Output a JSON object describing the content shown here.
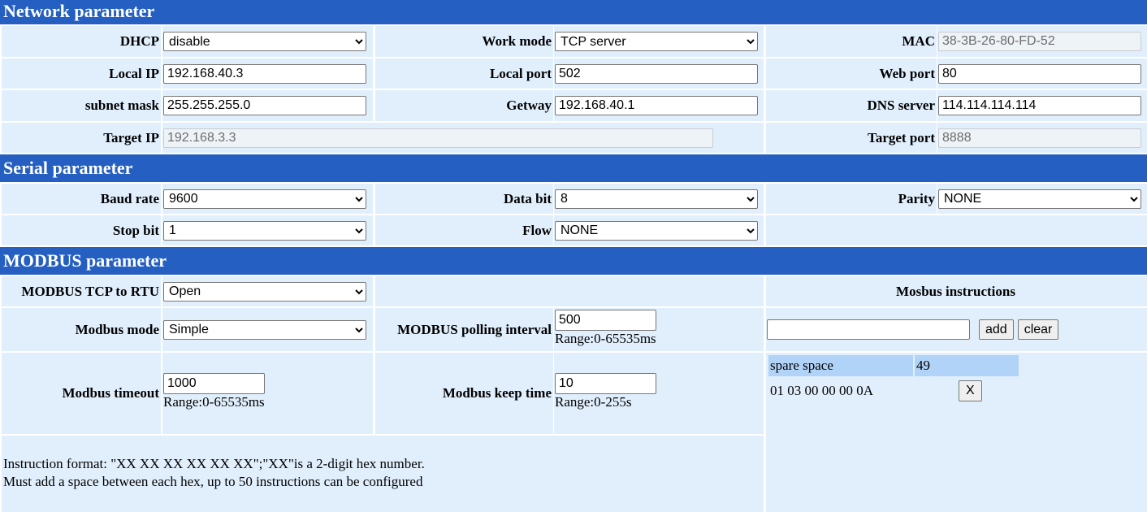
{
  "network": {
    "title": "Network parameter",
    "dhcp_label": "DHCP",
    "dhcp": "disable",
    "work_mode_label": "Work mode",
    "work_mode": "TCP server",
    "mac_label": "MAC",
    "mac": "38-3B-26-80-FD-52",
    "local_ip_label": "Local IP",
    "local_ip": "192.168.40.3",
    "local_port_label": "Local port",
    "local_port": "502",
    "web_port_label": "Web port",
    "web_port": "80",
    "subnet_label": "subnet mask",
    "subnet": "255.255.255.0",
    "gateway_label": "Getway",
    "gateway": "192.168.40.1",
    "dns_label": "DNS server",
    "dns": "114.114.114.114",
    "target_ip_label": "Target IP",
    "target_ip": "192.168.3.3",
    "target_port_label": "Target port",
    "target_port": "8888"
  },
  "serial": {
    "title": "Serial parameter",
    "baud_label": "Baud rate",
    "baud": "9600",
    "data_bit_label": "Data bit",
    "data_bit": "8",
    "parity_label": "Parity",
    "parity": "NONE",
    "stop_bit_label": "Stop bit",
    "stop_bit": "1",
    "flow_label": "Flow",
    "flow": "NONE"
  },
  "modbus": {
    "title": "MODBUS parameter",
    "tcp_rtu_label": "MODBUS TCP to RTU",
    "tcp_rtu": "Open",
    "mode_label": "Modbus mode",
    "mode": "Simple",
    "polling_label": "MODBUS polling interval",
    "polling": "500",
    "polling_range": "Range:0-65535ms",
    "timeout_label": "Modbus timeout",
    "timeout": "1000",
    "timeout_range": "Range:0-65535ms",
    "keep_label": "Modbus keep time",
    "keep": "10",
    "keep_range": "Range:0-255s",
    "note_line1": "Instruction format: \"XX XX XX XX XX XX\";\"XX\"is a 2-digit hex number.",
    "note_line2": "Must add a space between each hex, up to 50 instructions can be configured",
    "instructions": {
      "title": "Mosbus instructions",
      "input": "",
      "add": "add",
      "clear": "clear",
      "spare_label": "spare space",
      "spare": "49",
      "items": [
        {
          "cmd": "01 03 00 00 00 0A",
          "remove": "X"
        }
      ]
    }
  }
}
